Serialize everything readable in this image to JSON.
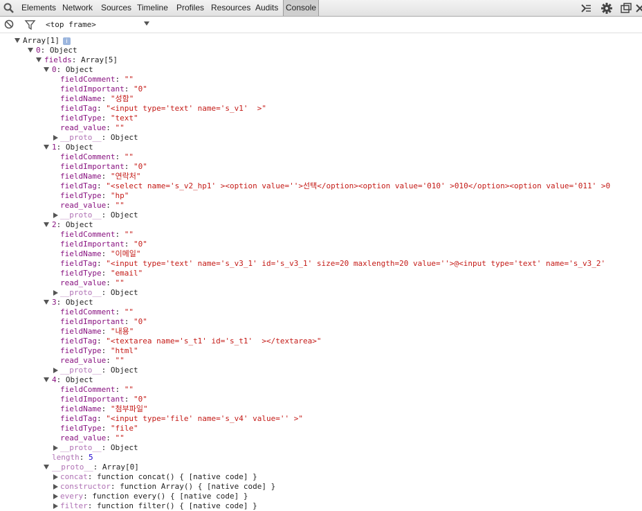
{
  "toolbar": {
    "tabs": [
      "Elements",
      "Network",
      "Sources",
      "Timeline",
      "Profiles",
      "Resources",
      "Audits",
      "Console"
    ],
    "active_tab": "Console"
  },
  "filterbar": {
    "frame_label": "<top frame>"
  },
  "console": {
    "lines": [
      {
        "indent": 0,
        "toggle": "open",
        "parts": [
          {
            "t": "Array[1]",
            "c": "plain"
          }
        ],
        "badge": "i"
      },
      {
        "indent": 1,
        "toggle": "open",
        "parts": [
          {
            "t": "0",
            "c": "key"
          },
          {
            "t": ": Object",
            "c": "plain"
          }
        ]
      },
      {
        "indent": 2,
        "toggle": "open",
        "parts": [
          {
            "t": "fields",
            "c": "key"
          },
          {
            "t": ": Array[5]",
            "c": "plain"
          }
        ]
      },
      {
        "indent": 3,
        "toggle": "open",
        "parts": [
          {
            "t": "0",
            "c": "key"
          },
          {
            "t": ": Object",
            "c": "plain"
          }
        ]
      },
      {
        "indent": 4,
        "parts": [
          {
            "t": "fieldComment",
            "c": "key"
          },
          {
            "t": ": ",
            "c": "plain"
          },
          {
            "t": "\"\"",
            "c": "str"
          }
        ]
      },
      {
        "indent": 4,
        "parts": [
          {
            "t": "fieldImportant",
            "c": "key"
          },
          {
            "t": ": ",
            "c": "plain"
          },
          {
            "t": "\"0\"",
            "c": "str"
          }
        ]
      },
      {
        "indent": 4,
        "parts": [
          {
            "t": "fieldName",
            "c": "key"
          },
          {
            "t": ": ",
            "c": "plain"
          },
          {
            "t": "\"성함\"",
            "c": "str"
          }
        ]
      },
      {
        "indent": 4,
        "parts": [
          {
            "t": "fieldTag",
            "c": "key"
          },
          {
            "t": ": ",
            "c": "plain"
          },
          {
            "t": "\"<input type='text' name='s_v1'  >\"",
            "c": "str"
          }
        ]
      },
      {
        "indent": 4,
        "parts": [
          {
            "t": "fieldType",
            "c": "key"
          },
          {
            "t": ": ",
            "c": "plain"
          },
          {
            "t": "\"text\"",
            "c": "str"
          }
        ]
      },
      {
        "indent": 4,
        "parts": [
          {
            "t": "read_value",
            "c": "key"
          },
          {
            "t": ": ",
            "c": "plain"
          },
          {
            "t": "\"\"",
            "c": "str"
          }
        ]
      },
      {
        "indent": 4,
        "toggle": "closed",
        "parts": [
          {
            "t": "__proto__",
            "c": "key-dim"
          },
          {
            "t": ": Object",
            "c": "plain"
          }
        ]
      },
      {
        "indent": 3,
        "toggle": "open",
        "parts": [
          {
            "t": "1",
            "c": "key"
          },
          {
            "t": ": Object",
            "c": "plain"
          }
        ]
      },
      {
        "indent": 4,
        "parts": [
          {
            "t": "fieldComment",
            "c": "key"
          },
          {
            "t": ": ",
            "c": "plain"
          },
          {
            "t": "\"\"",
            "c": "str"
          }
        ]
      },
      {
        "indent": 4,
        "parts": [
          {
            "t": "fieldImportant",
            "c": "key"
          },
          {
            "t": ": ",
            "c": "plain"
          },
          {
            "t": "\"0\"",
            "c": "str"
          }
        ]
      },
      {
        "indent": 4,
        "parts": [
          {
            "t": "fieldName",
            "c": "key"
          },
          {
            "t": ": ",
            "c": "plain"
          },
          {
            "t": "\"연락처\"",
            "c": "str"
          }
        ]
      },
      {
        "indent": 4,
        "parts": [
          {
            "t": "fieldTag",
            "c": "key"
          },
          {
            "t": ": ",
            "c": "plain"
          },
          {
            "t": "\"<select name='s_v2_hp1' ><option value=''>선택</option><option value='010' >010</option><option value='011' >0",
            "c": "str"
          }
        ]
      },
      {
        "indent": 4,
        "parts": [
          {
            "t": "fieldType",
            "c": "key"
          },
          {
            "t": ": ",
            "c": "plain"
          },
          {
            "t": "\"hp\"",
            "c": "str"
          }
        ]
      },
      {
        "indent": 4,
        "parts": [
          {
            "t": "read_value",
            "c": "key"
          },
          {
            "t": ": ",
            "c": "plain"
          },
          {
            "t": "\"\"",
            "c": "str"
          }
        ]
      },
      {
        "indent": 4,
        "toggle": "closed",
        "parts": [
          {
            "t": "__proto__",
            "c": "key-dim"
          },
          {
            "t": ": Object",
            "c": "plain"
          }
        ]
      },
      {
        "indent": 3,
        "toggle": "open",
        "parts": [
          {
            "t": "2",
            "c": "key"
          },
          {
            "t": ": Object",
            "c": "plain"
          }
        ]
      },
      {
        "indent": 4,
        "parts": [
          {
            "t": "fieldComment",
            "c": "key"
          },
          {
            "t": ": ",
            "c": "plain"
          },
          {
            "t": "\"\"",
            "c": "str"
          }
        ]
      },
      {
        "indent": 4,
        "parts": [
          {
            "t": "fieldImportant",
            "c": "key"
          },
          {
            "t": ": ",
            "c": "plain"
          },
          {
            "t": "\"0\"",
            "c": "str"
          }
        ]
      },
      {
        "indent": 4,
        "parts": [
          {
            "t": "fieldName",
            "c": "key"
          },
          {
            "t": ": ",
            "c": "plain"
          },
          {
            "t": "\"이메일\"",
            "c": "str"
          }
        ]
      },
      {
        "indent": 4,
        "parts": [
          {
            "t": "fieldTag",
            "c": "key"
          },
          {
            "t": ": ",
            "c": "plain"
          },
          {
            "t": "\"<input type='text' name='s_v3_1' id='s_v3_1' size=20 maxlength=20 value=''>@<input type='text' name='s_v3_2'",
            "c": "str"
          }
        ]
      },
      {
        "indent": 4,
        "parts": [
          {
            "t": "fieldType",
            "c": "key"
          },
          {
            "t": ": ",
            "c": "plain"
          },
          {
            "t": "\"email\"",
            "c": "str"
          }
        ]
      },
      {
        "indent": 4,
        "parts": [
          {
            "t": "read_value",
            "c": "key"
          },
          {
            "t": ": ",
            "c": "plain"
          },
          {
            "t": "\"\"",
            "c": "str"
          }
        ]
      },
      {
        "indent": 4,
        "toggle": "closed",
        "parts": [
          {
            "t": "__proto__",
            "c": "key-dim"
          },
          {
            "t": ": Object",
            "c": "plain"
          }
        ]
      },
      {
        "indent": 3,
        "toggle": "open",
        "parts": [
          {
            "t": "3",
            "c": "key"
          },
          {
            "t": ": Object",
            "c": "plain"
          }
        ]
      },
      {
        "indent": 4,
        "parts": [
          {
            "t": "fieldComment",
            "c": "key"
          },
          {
            "t": ": ",
            "c": "plain"
          },
          {
            "t": "\"\"",
            "c": "str"
          }
        ]
      },
      {
        "indent": 4,
        "parts": [
          {
            "t": "fieldImportant",
            "c": "key"
          },
          {
            "t": ": ",
            "c": "plain"
          },
          {
            "t": "\"0\"",
            "c": "str"
          }
        ]
      },
      {
        "indent": 4,
        "parts": [
          {
            "t": "fieldName",
            "c": "key"
          },
          {
            "t": ": ",
            "c": "plain"
          },
          {
            "t": "\"내용\"",
            "c": "str"
          }
        ]
      },
      {
        "indent": 4,
        "parts": [
          {
            "t": "fieldTag",
            "c": "key"
          },
          {
            "t": ": ",
            "c": "plain"
          },
          {
            "t": "\"<textarea name='s_t1' id='s_t1'  ></textarea>\"",
            "c": "str"
          }
        ]
      },
      {
        "indent": 4,
        "parts": [
          {
            "t": "fieldType",
            "c": "key"
          },
          {
            "t": ": ",
            "c": "plain"
          },
          {
            "t": "\"html\"",
            "c": "str"
          }
        ]
      },
      {
        "indent": 4,
        "parts": [
          {
            "t": "read_value",
            "c": "key"
          },
          {
            "t": ": ",
            "c": "plain"
          },
          {
            "t": "\"\"",
            "c": "str"
          }
        ]
      },
      {
        "indent": 4,
        "toggle": "closed",
        "parts": [
          {
            "t": "__proto__",
            "c": "key-dim"
          },
          {
            "t": ": Object",
            "c": "plain"
          }
        ]
      },
      {
        "indent": 3,
        "toggle": "open",
        "parts": [
          {
            "t": "4",
            "c": "key"
          },
          {
            "t": ": Object",
            "c": "plain"
          }
        ]
      },
      {
        "indent": 4,
        "parts": [
          {
            "t": "fieldComment",
            "c": "key"
          },
          {
            "t": ": ",
            "c": "plain"
          },
          {
            "t": "\"\"",
            "c": "str"
          }
        ]
      },
      {
        "indent": 4,
        "parts": [
          {
            "t": "fieldImportant",
            "c": "key"
          },
          {
            "t": ": ",
            "c": "plain"
          },
          {
            "t": "\"0\"",
            "c": "str"
          }
        ]
      },
      {
        "indent": 4,
        "parts": [
          {
            "t": "fieldName",
            "c": "key"
          },
          {
            "t": ": ",
            "c": "plain"
          },
          {
            "t": "\"첨부파일\"",
            "c": "str"
          }
        ]
      },
      {
        "indent": 4,
        "parts": [
          {
            "t": "fieldTag",
            "c": "key"
          },
          {
            "t": ": ",
            "c": "plain"
          },
          {
            "t": "\"<input type='file' name='s_v4' value='' >\"",
            "c": "str"
          }
        ]
      },
      {
        "indent": 4,
        "parts": [
          {
            "t": "fieldType",
            "c": "key"
          },
          {
            "t": ": ",
            "c": "plain"
          },
          {
            "t": "\"file\"",
            "c": "str"
          }
        ]
      },
      {
        "indent": 4,
        "parts": [
          {
            "t": "read_value",
            "c": "key"
          },
          {
            "t": ": ",
            "c": "plain"
          },
          {
            "t": "\"\"",
            "c": "str"
          }
        ]
      },
      {
        "indent": 4,
        "toggle": "closed",
        "parts": [
          {
            "t": "__proto__",
            "c": "key-dim"
          },
          {
            "t": ": Object",
            "c": "plain"
          }
        ]
      },
      {
        "indent": 3,
        "parts": [
          {
            "t": "length",
            "c": "key-dim"
          },
          {
            "t": ": ",
            "c": "plain"
          },
          {
            "t": "5",
            "c": "num"
          }
        ]
      },
      {
        "indent": 3,
        "toggle": "open",
        "parts": [
          {
            "t": "__proto__",
            "c": "key-dim"
          },
          {
            "t": ": Array[0]",
            "c": "plain"
          }
        ]
      },
      {
        "indent": 4,
        "toggle": "closed",
        "parts": [
          {
            "t": "concat",
            "c": "key-dim"
          },
          {
            "t": ": function concat() { [native code] }",
            "c": "plain"
          }
        ]
      },
      {
        "indent": 4,
        "toggle": "closed",
        "parts": [
          {
            "t": "constructor",
            "c": "key-dim"
          },
          {
            "t": ": function Array() { [native code] }",
            "c": "plain"
          }
        ]
      },
      {
        "indent": 4,
        "toggle": "closed",
        "parts": [
          {
            "t": "every",
            "c": "key-dim"
          },
          {
            "t": ": function every() { [native code] }",
            "c": "plain"
          }
        ]
      },
      {
        "indent": 4,
        "toggle": "closed",
        "parts": [
          {
            "t": "filter",
            "c": "key-dim"
          },
          {
            "t": ": function filter() { [native code] }",
            "c": "plain"
          }
        ]
      }
    ]
  },
  "colors": {
    "key": "#881280",
    "string": "#c41a16",
    "number": "#1c00cf"
  }
}
